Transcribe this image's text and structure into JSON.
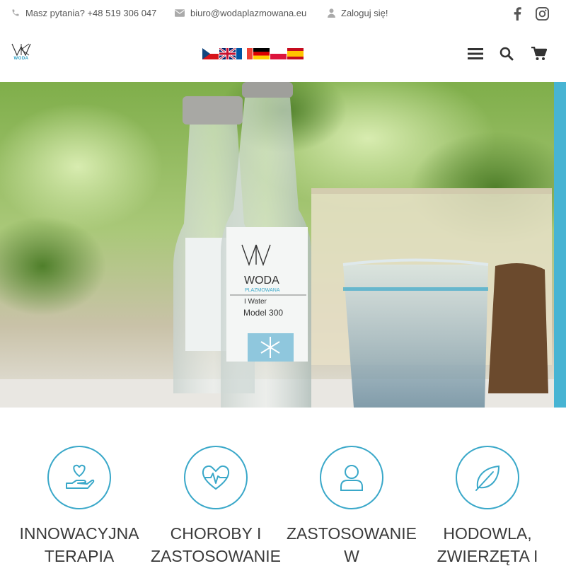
{
  "topbar": {
    "phone": "Masz pytania? +48 519 306 047",
    "email": "biuro@wodaplazmowana.eu",
    "login": "Zaloguj się!"
  },
  "header": {
    "logo_text": "WODA",
    "languages": [
      "Čeština",
      "English",
      "Français",
      "Deutsch",
      "Polski",
      "Español"
    ]
  },
  "hero": {
    "bottle_brand": "WODA",
    "bottle_sub": "PLAZMOWANA",
    "bottle_line": "I Water",
    "bottle_model": "Model 300"
  },
  "features": [
    {
      "title": "INNOWACYJNA TERAPIA",
      "icon": "hand-heart-icon"
    },
    {
      "title": "CHOROBY I ZASTOSOWANIE",
      "icon": "heartbeat-icon"
    },
    {
      "title": "ZASTOSOWANIE W",
      "icon": "user-icon"
    },
    {
      "title": "HODOWLA, ZWIERZĘTA I",
      "icon": "leaf-icon"
    }
  ],
  "colors": {
    "accent": "#3aa8c9",
    "text": "#555555"
  }
}
